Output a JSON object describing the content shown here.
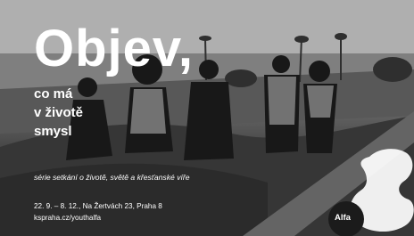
{
  "poster": {
    "title": "Objev,",
    "subtitle_lines": [
      "co má",
      "v životě",
      "smysl"
    ],
    "tagline": "série setkání o životě, světě a křesťanské víře",
    "dates": "22. 9. – 8. 12., Na Žertvách 23, Praha 8",
    "url": "kspraha.cz/youthalfa",
    "brand": "Alfa"
  }
}
